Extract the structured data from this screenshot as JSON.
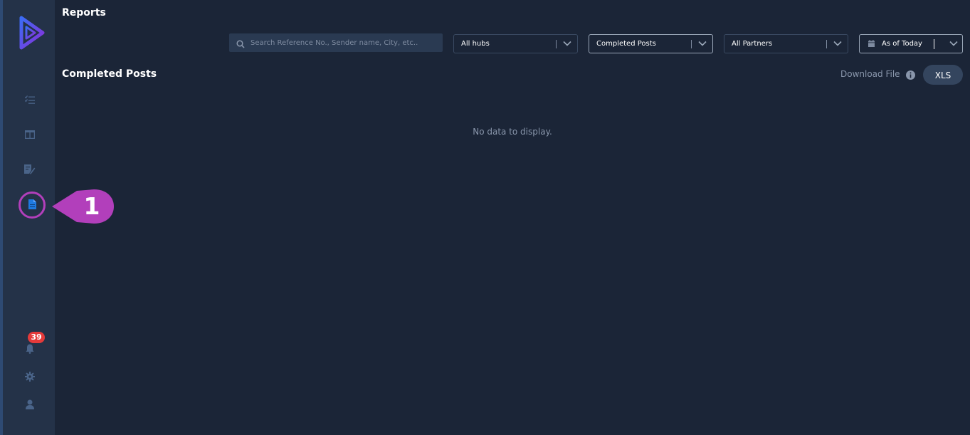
{
  "page": {
    "title": "Reports"
  },
  "sidebar": {
    "items": [
      {
        "name": "tasks",
        "icon": "checklist-icon"
      },
      {
        "name": "board",
        "icon": "columns-icon"
      },
      {
        "name": "edit",
        "icon": "edit-document-icon"
      },
      {
        "name": "reports",
        "icon": "document-icon",
        "active": true
      }
    ],
    "notifications": {
      "icon": "bell-icon",
      "badge": "39"
    },
    "settings": {
      "icon": "gear-icon"
    },
    "profile": {
      "icon": "user-icon"
    }
  },
  "callout": {
    "number": "1",
    "color": "#b23fbb"
  },
  "filters": {
    "search_placeholder": "Search Reference No., Sender name, City, etc..",
    "hubs": "All hubs",
    "report_type": "Completed Posts",
    "partners": "All Partners",
    "date": "As of Today"
  },
  "section": {
    "title": "Completed Posts",
    "download_label": "Download File",
    "xls_label": "XLS",
    "empty_message": "No data to display."
  },
  "colors": {
    "background": "#1b2537",
    "sidebar": "#243248",
    "badge": "#e53a3a",
    "accent": "#1f7ae0"
  }
}
